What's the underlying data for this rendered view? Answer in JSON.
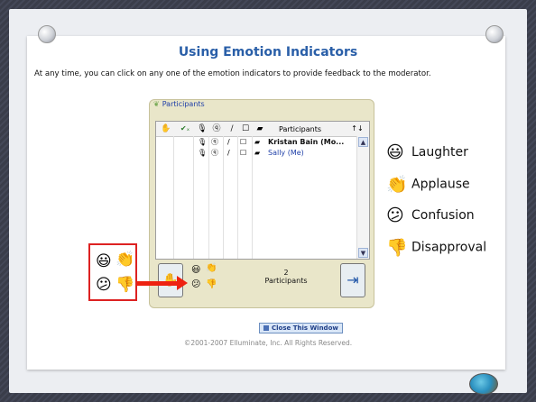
{
  "slide": {
    "title": "Using Emotion Indicators",
    "description": "At any time, you can click on any one of the emotion indicators to provide feedback to the moderator."
  },
  "panel": {
    "tab_label": "Participants",
    "header_label": "Participants",
    "sort_icon": "↑↓",
    "participants": [
      {
        "name": "Kristan Bain (Mo...",
        "bold": true,
        "color": "#111111"
      },
      {
        "name": "Sally (Me)",
        "bold": false,
        "color": "#1f3fa8"
      }
    ],
    "count_number": "2",
    "count_label": "Participants"
  },
  "legend": [
    {
      "icon": "laughter-icon",
      "glyph": "😃",
      "label": "Laughter"
    },
    {
      "icon": "applause-icon",
      "glyph": "👏",
      "label": "Applause"
    },
    {
      "icon": "confusion-icon",
      "glyph": "😕",
      "label": "Confusion"
    },
    {
      "icon": "disapproval-icon",
      "glyph": "👎",
      "label": "Disapproval"
    }
  ],
  "footer": {
    "close_button": "Close This Window",
    "copyright": "©2001-2007 Elluminate, Inc. All Rights Reserved."
  },
  "colors": {
    "title": "#2a5fa8",
    "highlight": "#dd2222",
    "panel_bg": "#e9e6c9"
  }
}
